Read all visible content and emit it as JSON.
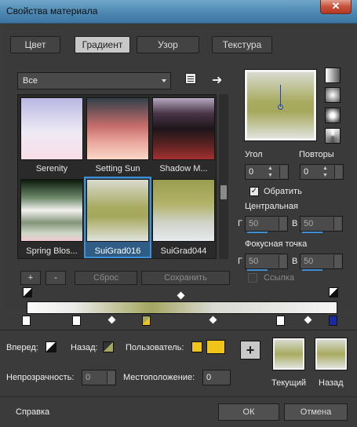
{
  "window": {
    "title": "Свойства материала",
    "close": "✕"
  },
  "tabs": [
    {
      "label": "Цвет"
    },
    {
      "label": "Градиент"
    },
    {
      "label": "Узор"
    },
    {
      "label": "Текстура"
    }
  ],
  "category": {
    "selected": "Все"
  },
  "gradients": [
    {
      "name": "Serenity"
    },
    {
      "name": "Setting Sun"
    },
    {
      "name": "Shadow M..."
    },
    {
      "name": "Spring Blos..."
    },
    {
      "name": "SuiGrad016"
    },
    {
      "name": "SuiGrad044"
    }
  ],
  "list_buttons": {
    "add": "+",
    "remove": "-",
    "reset": "Сброс",
    "save": "Сохранить"
  },
  "angle": {
    "label": "Угол",
    "value": "0"
  },
  "repeats": {
    "label": "Повторы",
    "value": "0"
  },
  "invert": {
    "label": "Обратить",
    "checked": true
  },
  "center": {
    "label": "Центральная",
    "h_label": "Г",
    "h_value": "50",
    "v_label": "В",
    "v_value": "50"
  },
  "focal": {
    "label": "Фокусная точка",
    "h_label": "Г",
    "h_value": "50",
    "v_label": "В",
    "v_value": "50"
  },
  "link": {
    "label": "Ссылка"
  },
  "editor": {
    "forward": "Вперед:",
    "back": "Назад:",
    "user": "Пользователь:",
    "opacity_label": "Непрозрачность:",
    "opacity_value": "0",
    "position_label": "Местоположение:",
    "position_value": "0",
    "add_stop": "+"
  },
  "swatches": {
    "current": "Текущий",
    "previous": "Назад"
  },
  "footer": {
    "help": "Справка",
    "ok": "ОК",
    "cancel": "Отмена"
  },
  "colors": {
    "accent": "#3d8fd6",
    "user_color": "#f0c419"
  }
}
